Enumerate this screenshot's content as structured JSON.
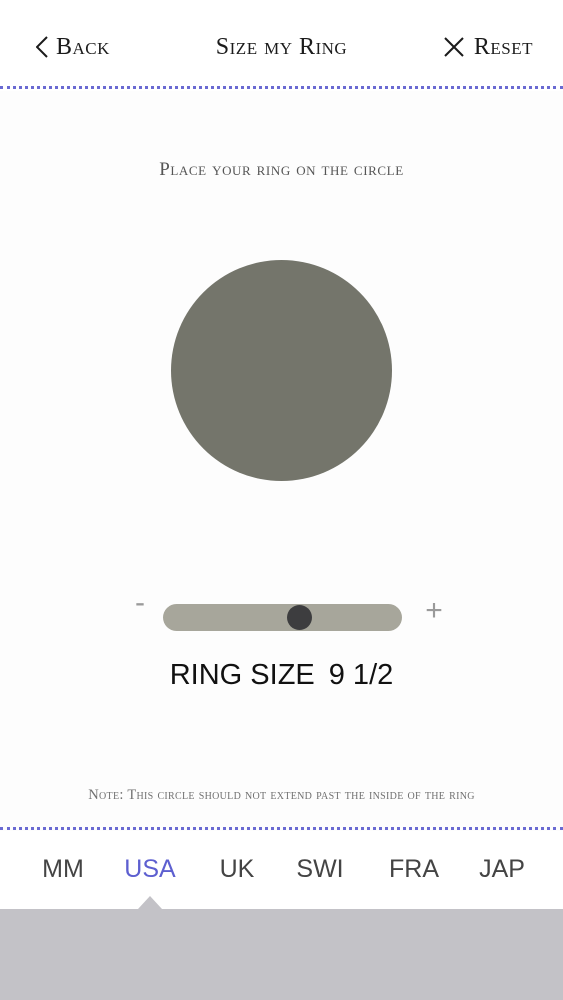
{
  "header": {
    "back_label": "Back",
    "title": "Size my Ring",
    "reset_label": "Reset"
  },
  "instruction": "Place your ring on the circle",
  "slider": {
    "minus_label": "-",
    "plus_label": "+",
    "value_fraction": 0.57
  },
  "ring_size": {
    "label": "RING SIZE",
    "value": "9 1/2"
  },
  "note": "Note: This circle should not extend past the inside of the ring",
  "units": {
    "items": [
      "MM",
      "USA",
      "UK",
      "SWI",
      "FRA",
      "JAP"
    ],
    "selected": "USA"
  },
  "colors": {
    "accent": "#5d5fd0",
    "circle": "#74756b",
    "track": "#a7a69b",
    "thumb": "#3d3d3f",
    "bottom_panel": "#c3c2c7"
  }
}
